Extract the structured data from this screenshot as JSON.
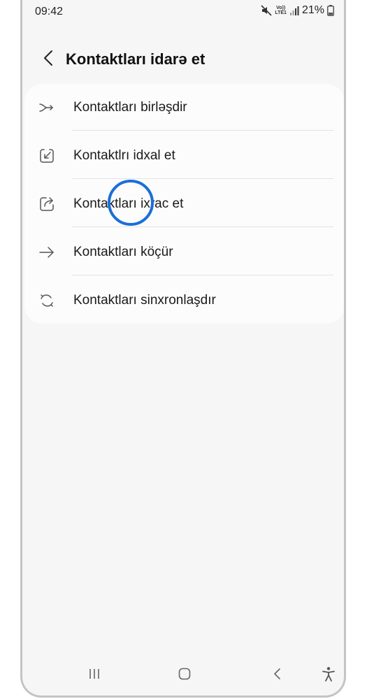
{
  "status_bar": {
    "time": "09:42",
    "network_top": "Vo))",
    "network_bottom": "LTE1",
    "battery_percent": "21%",
    "icons": [
      "mute-icon",
      "signal-icon",
      "battery-icon"
    ]
  },
  "header": {
    "title": "Kontaktları idarə et",
    "back_icon": "chevron-left-icon"
  },
  "menu": {
    "items": [
      {
        "label": "Kontaktları birləşdir",
        "icon": "merge-icon"
      },
      {
        "label": "Kontaktlrı idxal et",
        "icon": "import-icon"
      },
      {
        "label": "Kontaktları ixrac et",
        "icon": "export-icon"
      },
      {
        "label": "Kontaktları köçür",
        "icon": "arrow-right-icon"
      },
      {
        "label": "Kontaktları sinxronlaşdır",
        "icon": "sync-icon"
      }
    ]
  },
  "touch_indicator": {
    "color": "#1a6fd8",
    "target": "Kontaktları ixrac et"
  },
  "nav_bar": {
    "icons": [
      "recents-icon",
      "home-icon",
      "back-icon",
      "accessibility-icon"
    ]
  },
  "colors": {
    "background": "#f6f6f6",
    "card": "#fcfcfc",
    "text": "#1a1a1a",
    "icon": "#555555"
  }
}
